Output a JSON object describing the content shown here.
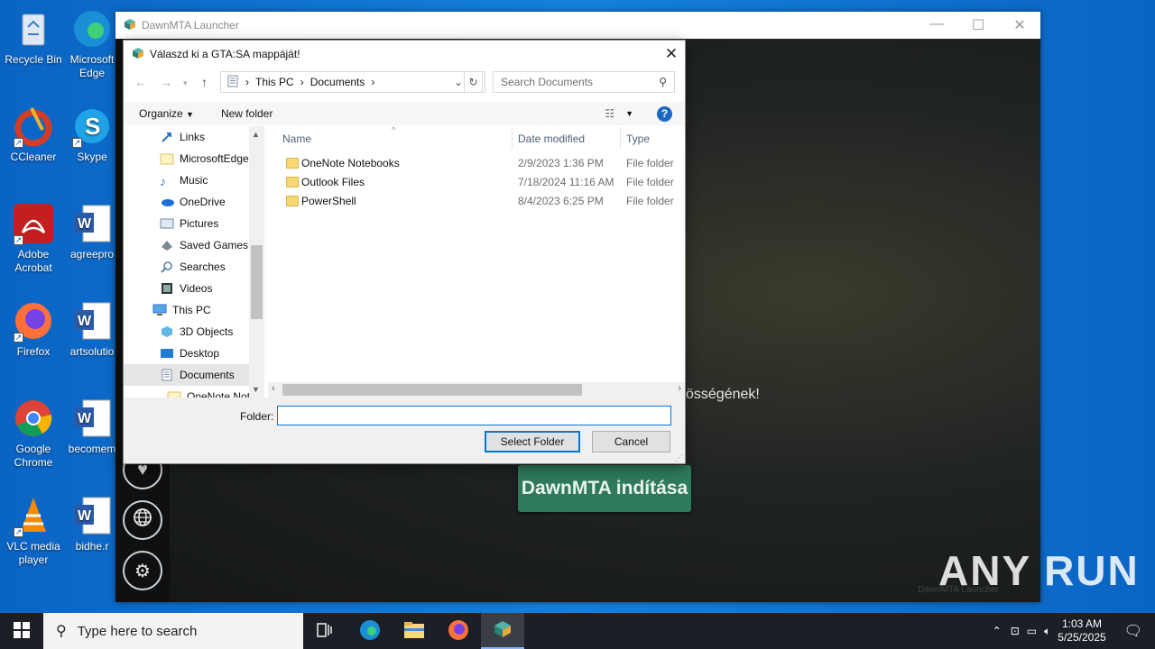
{
  "desktop": {
    "icons": [
      {
        "label": "Recycle Bin"
      },
      {
        "label": "Microsoft Edge"
      },
      {
        "label": "CCleaner"
      },
      {
        "label": "Skype"
      },
      {
        "label": "Adobe Acrobat"
      },
      {
        "label": "agreepro"
      },
      {
        "label": "Firefox"
      },
      {
        "label": "artsolutio"
      },
      {
        "label": "Google Chrome"
      },
      {
        "label": "becomem"
      },
      {
        "label": "VLC media player"
      },
      {
        "label": "bidhe.r"
      }
    ]
  },
  "launcher": {
    "title": "DawnMTA Launcher",
    "start_button": "DawnMTA indítása",
    "bg_text": "össégének!",
    "watermark": "DawnMTA Launcher"
  },
  "dialog": {
    "title": "Válaszd ki a GTA:SA mappáját!",
    "breadcrumb": [
      "This PC",
      "Documents"
    ],
    "search_placeholder": "Search Documents",
    "toolbar": {
      "organize": "Organize",
      "new_folder": "New folder"
    },
    "nav_items": [
      {
        "label": "Links"
      },
      {
        "label": "MicrosoftEdge"
      },
      {
        "label": "Music"
      },
      {
        "label": "OneDrive"
      },
      {
        "label": "Pictures"
      },
      {
        "label": "Saved Games"
      },
      {
        "label": "Searches"
      },
      {
        "label": "Videos"
      },
      {
        "label": "This PC"
      },
      {
        "label": "3D Objects"
      },
      {
        "label": "Desktop"
      },
      {
        "label": "Documents"
      },
      {
        "label": "OneNote Not"
      }
    ],
    "columns": {
      "name": "Name",
      "date": "Date modified",
      "type": "Type"
    },
    "rows": [
      {
        "name": "OneNote Notebooks",
        "date": "2/9/2023 1:36 PM",
        "type": "File folder"
      },
      {
        "name": "Outlook Files",
        "date": "7/18/2024 11:16 AM",
        "type": "File folder"
      },
      {
        "name": "PowerShell",
        "date": "8/4/2023 6:25 PM",
        "type": "File folder"
      }
    ],
    "folder_label": "Folder:",
    "folder_value": "",
    "select_button": "Select Folder",
    "cancel_button": "Cancel"
  },
  "taskbar": {
    "search_placeholder": "Type here to search",
    "time": "1:03 AM",
    "date": "5/25/2025"
  },
  "watermark": "ANY RUN"
}
